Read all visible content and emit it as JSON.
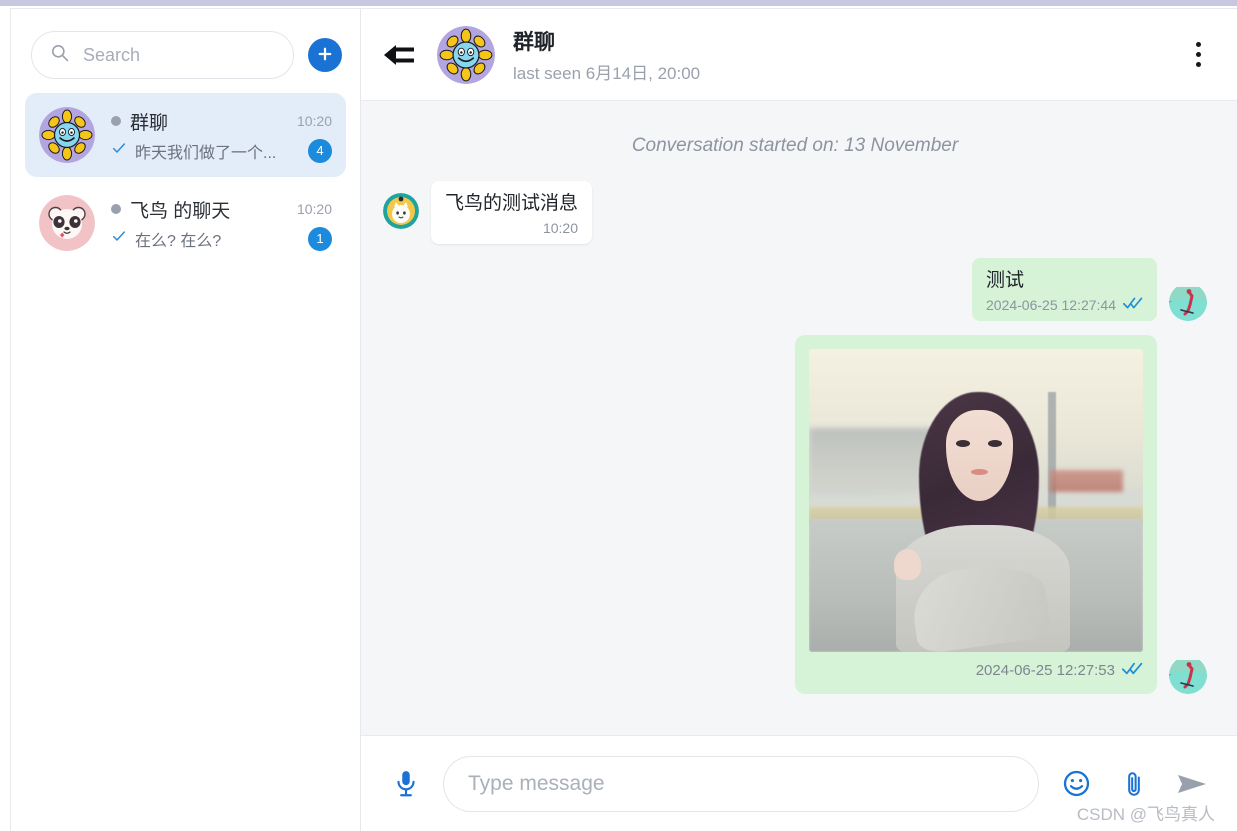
{
  "sidebar": {
    "search": {
      "placeholder": "Search",
      "value": "",
      "icon": "search-icon"
    },
    "add_button": {
      "label": "+",
      "icon": "plus-icon",
      "color": "#1a73d4"
    },
    "chats": [
      {
        "name": "群聊",
        "time": "10:20",
        "preview": "昨天我们做了一个...",
        "badge": "4",
        "tick": "✓",
        "avatar": "sunflower-avatar",
        "active": true
      },
      {
        "name": "飞鸟 的聊天",
        "time": "10:20",
        "preview": "在么? 在么?",
        "badge": "1",
        "tick": "✓",
        "avatar": "panda-avatar",
        "active": false
      }
    ]
  },
  "header": {
    "back_icon": "back-arrow-icon",
    "avatar": "sunflower-avatar",
    "title": "群聊",
    "subtitle": "last seen 6月14日, 20:00",
    "menu_icon": "more-vertical-icon"
  },
  "conversation": {
    "start_notice": "Conversation started on: 13 November",
    "messages": [
      {
        "direction": "in",
        "avatar": "cat-avatar",
        "text": "飞鸟的测试消息",
        "time": "10:20",
        "status": ""
      },
      {
        "direction": "out",
        "avatar": "skier-avatar",
        "text": "测试",
        "time": "2024-06-25 12:27:44",
        "status": "✓✓"
      },
      {
        "direction": "out",
        "avatar": "skier-avatar",
        "type": "image",
        "text": "",
        "time": "2024-06-25 12:27:53",
        "status": "✓✓"
      }
    ]
  },
  "composer": {
    "mic_icon": "microphone-icon",
    "input": {
      "placeholder": "Type message",
      "value": ""
    },
    "emoji_icon": "emoji-icon",
    "attach_icon": "paperclip-icon",
    "send_icon": "send-icon"
  },
  "watermark": "CSDN @飞鸟真人",
  "colors": {
    "accent_blue": "#1a73d4",
    "badge_blue": "#1c8bdd",
    "out_bubble_green": "#d6f3d8",
    "panel_bg": "#f5f6f8",
    "active_item": "#e3ecf9"
  }
}
